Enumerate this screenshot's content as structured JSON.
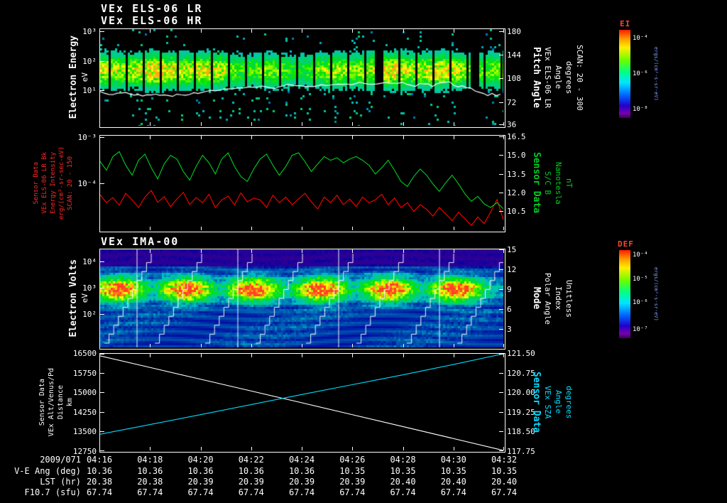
{
  "header": {
    "title_line1": "VEx ELS-06 LR",
    "title_line2": "VEx ELS-06 HR"
  },
  "colors": {
    "background": "#000000",
    "foreground": "#ffffff",
    "red": "#ff2a2a",
    "green": "#00cc22",
    "cyan": "#00ddff",
    "colorbar_title": "#ff4433"
  },
  "panels": {
    "els_spectrogram": {
      "left_axis": {
        "title": "Electron Energy",
        "units": "eV",
        "ticks": [
          "10³",
          "10²",
          "10¹"
        ]
      },
      "right_axis": {
        "labels": [
          "Pitch Angle",
          "VEx ELS-06 LR",
          "Angle",
          "degrees",
          "SCAN: 20 - 300"
        ],
        "ticks": [
          "180",
          "144",
          "108",
          "72",
          "36"
        ]
      },
      "colorbar": {
        "title": "EI",
        "ticks": [
          "10⁻⁴",
          "10⁻⁶",
          "10⁻⁸"
        ],
        "units": "ergs/(cm²-s-sr-eV)"
      }
    },
    "line_panel": {
      "left_axis": {
        "labels": [
          "Sensor Data",
          "VEx ELS-06 LR Bk",
          "Energy Intensity",
          "erg/(cm²-sr-sec-eV)",
          "SCAN: 20 - 150"
        ],
        "ticks": [
          "10⁻³",
          "10⁻⁴"
        ]
      },
      "right_axis": {
        "labels": [
          "Sensor Data",
          "S/C B",
          "Nanotesla",
          "nT"
        ],
        "ticks": [
          "16.5",
          "15.0",
          "13.5",
          "12.0",
          "10.5"
        ]
      }
    },
    "ima_spectrogram": {
      "title": "VEx IMA-00",
      "left_axis": {
        "title": "Electron Volts",
        "units": "eV",
        "ticks": [
          "10⁴",
          "10³",
          "10²"
        ]
      },
      "right_axis": {
        "labels": [
          "Mode",
          "Polar Angle",
          "Index",
          "Unitless"
        ],
        "ticks": [
          "15",
          "12",
          "9",
          "6",
          "3"
        ]
      },
      "colorbar": {
        "title": "DEF",
        "ticks": [
          "10⁻⁴",
          "10⁻⁵",
          "10⁻⁶",
          "10⁻⁷"
        ],
        "units": "ergs/(cm²-s-sr-eV)"
      }
    },
    "ephemeris_panel": {
      "left_axis": {
        "labels": [
          "Sensor Data",
          "VEx Alt/Venus/Pd",
          "Distance",
          "km"
        ],
        "ticks": [
          "16500",
          "15750",
          "15000",
          "14250",
          "13500",
          "12750"
        ]
      },
      "right_axis": {
        "labels": [
          "Sensor Data",
          "VEx SZA",
          "Angle",
          "degrees"
        ],
        "ticks": [
          "121.50",
          "120.75",
          "120.00",
          "119.25",
          "118.50",
          "117.75"
        ]
      }
    }
  },
  "time_axis": {
    "date": "2009/071",
    "ticks": [
      "04:16",
      "04:18",
      "04:20",
      "04:22",
      "04:24",
      "04:26",
      "04:28",
      "04:30",
      "04:32"
    ]
  },
  "footer_rows": [
    {
      "label": "V-E Ang (deg)",
      "values": [
        "10.36",
        "10.36",
        "10.36",
        "10.36",
        "10.36",
        "10.35",
        "10.35",
        "10.35",
        "10.35"
      ]
    },
    {
      "label": "LST (hr)",
      "values": [
        "20.38",
        "20.38",
        "20.39",
        "20.39",
        "20.39",
        "20.39",
        "20.40",
        "20.40",
        "20.40"
      ]
    },
    {
      "label": "F10.7 (sfu)",
      "values": [
        "67.74",
        "67.74",
        "67.74",
        "67.74",
        "67.74",
        "67.74",
        "67.74",
        "67.74",
        "67.74"
      ]
    }
  ],
  "chart_data": [
    {
      "type": "heatmap",
      "name": "els_energy_spectrogram",
      "title": "VEx ELS-06 LR / VEx ELS-06 HR",
      "x_start": "04:16",
      "x_end": "04:32",
      "ylabel": "Electron Energy (eV)",
      "y_scale": "log",
      "y_ticks": [
        10,
        100,
        1000
      ],
      "z_label": "EI ergs/(cm²-s-sr-eV)",
      "z_ticks": [
        0.0001,
        1e-06,
        1e-08
      ],
      "right_axis": {
        "label": "Pitch Angle (degrees) SCAN: 20 - 300",
        "ticks": [
          180,
          144,
          108,
          72,
          36
        ]
      },
      "features": [
        "intense green-yellow band between ~10 and ~300 eV across full interval",
        "white jagged mean-energy trace along lower edge of band",
        "regular narrow black data-gap columns",
        "sparse cyan counts above and below main band"
      ]
    },
    {
      "type": "line",
      "name": "field_and_intensity",
      "x_ticks": [
        "04:16",
        "04:18",
        "04:20",
        "04:22",
        "04:24",
        "04:26",
        "04:28",
        "04:30",
        "04:32"
      ],
      "series": [
        {
          "name": "S/C B (nT)",
          "color": "#00cc22",
          "axis": "right",
          "axis_range": [
            10.5,
            16.5
          ],
          "values": [
            14.5,
            13.8,
            14.9,
            15.3,
            14.2,
            13.4,
            14.6,
            15.1,
            14.0,
            13.1,
            14.3,
            15.0,
            14.7,
            13.7,
            13.0,
            14.1,
            15.0,
            14.4,
            13.5,
            14.7,
            15.2,
            14.1,
            13.3,
            12.9,
            13.9,
            14.7,
            15.1,
            14.2,
            13.4,
            14.1,
            15.0,
            15.2,
            14.5,
            13.7,
            14.3,
            14.9,
            14.6,
            14.8,
            14.4,
            14.7,
            14.9,
            14.6,
            14.2,
            13.5,
            14.0,
            14.6,
            13.8,
            12.9,
            12.5,
            13.3,
            13.9,
            13.4,
            12.7,
            12.1,
            12.8,
            13.4,
            12.7,
            11.9,
            11.3,
            11.7,
            11.1,
            10.8,
            11.2,
            10.7
          ]
        },
        {
          "name": "VEx ELS-06 LR Bk Energy Intensity erg/(cm²-sr-sec-eV)",
          "color": "#ff0000",
          "axis": "left",
          "axis_scale": "log",
          "axis_range_log10": [
            -5,
            -3
          ],
          "log10_values": [
            -4.25,
            -4.42,
            -4.31,
            -4.47,
            -4.22,
            -4.36,
            -4.52,
            -4.3,
            -4.16,
            -4.41,
            -4.29,
            -4.5,
            -4.34,
            -4.2,
            -4.46,
            -4.31,
            -4.42,
            -4.24,
            -4.52,
            -4.36,
            -4.28,
            -4.46,
            -4.21,
            -4.4,
            -4.32,
            -4.36,
            -4.52,
            -4.26,
            -4.42,
            -4.3,
            -4.46,
            -4.34,
            -4.22,
            -4.4,
            -4.55,
            -4.3,
            -4.42,
            -4.26,
            -4.46,
            -4.34,
            -4.5,
            -4.3,
            -4.42,
            -4.36,
            -4.24,
            -4.46,
            -4.32,
            -4.52,
            -4.42,
            -4.6,
            -4.46,
            -4.56,
            -4.7,
            -4.52,
            -4.66,
            -4.8,
            -4.62,
            -4.76,
            -4.9,
            -4.72,
            -4.86,
            -4.62,
            -4.35,
            -4.78
          ]
        }
      ]
    },
    {
      "type": "heatmap",
      "name": "ima_spectrogram",
      "title": "VEx IMA-00",
      "x_start": "04:16",
      "x_end": "04:32",
      "ylabel": "Electron Volts (eV)",
      "y_scale": "log",
      "y_ticks": [
        100,
        1000,
        10000
      ],
      "z_label": "DEF ergs/(cm²-s-sr-eV)",
      "z_ticks": [
        0.0001,
        1e-05,
        1e-06,
        1e-07
      ],
      "right_axis": {
        "label": "Mode / Polar Angle Index (Unitless)",
        "ticks": [
          15,
          12,
          9,
          6,
          3
        ]
      },
      "features": [
        "periodic bright red-yellow ion blobs near 1 keV roughly every 2 minutes",
        "stepped diagonal white elevation-scan traces",
        "vertical white mode-boundary lines",
        "blue striped background counts"
      ]
    },
    {
      "type": "line",
      "name": "ephemeris",
      "x_ticks": [
        "04:16",
        "04:18",
        "04:20",
        "04:22",
        "04:24",
        "04:26",
        "04:28",
        "04:30",
        "04:32"
      ],
      "series": [
        {
          "name": "VEx Alt/Venus/Pd Distance (km)",
          "color": "#ffffff",
          "axis": "left",
          "axis_range": [
            12750,
            16500
          ],
          "values": [
            16420,
            15965,
            15510,
            15055,
            14600,
            14140,
            13680,
            13215,
            12750
          ]
        },
        {
          "name": "VEx SZA (degrees)",
          "color": "#00ddff",
          "axis": "right",
          "axis_range": [
            117.75,
            121.5
          ],
          "values": [
            118.38,
            118.76,
            119.14,
            119.53,
            119.92,
            120.3,
            120.68,
            121.08,
            121.5
          ]
        }
      ]
    }
  ]
}
